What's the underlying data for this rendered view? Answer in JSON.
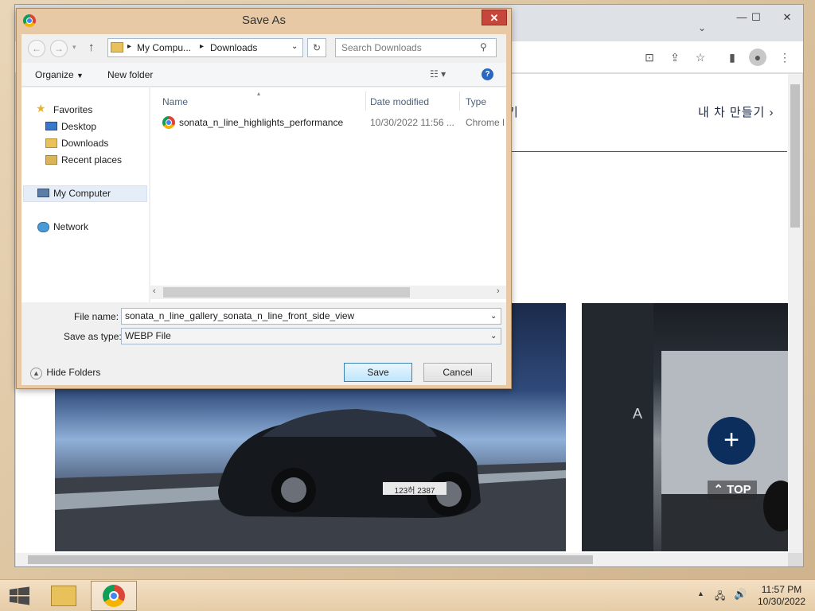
{
  "browser": {
    "korean_link": "내 차 만들기",
    "partial_korean": "기",
    "top_button": "TOP",
    "plate_text": "123허 2387"
  },
  "dialog": {
    "title": "Save As",
    "breadcrumb": [
      "My Compu...",
      "Downloads"
    ],
    "search_placeholder": "Search Downloads",
    "organize_label": "Organize",
    "new_folder_label": "New folder",
    "nav": {
      "favorites": "Favorites",
      "items": [
        "Desktop",
        "Downloads",
        "Recent places"
      ],
      "my_computer": "My Computer",
      "network": "Network"
    },
    "columns": {
      "name": "Name",
      "date": "Date modified",
      "type": "Type"
    },
    "files": [
      {
        "name": "sonata_n_line_highlights_performance",
        "date": "10/30/2022 11:56 ...",
        "type": "Chrome H"
      }
    ],
    "file_name_label": "File name:",
    "file_name_value": "sonata_n_line_gallery_sonata_n_line_front_side_view",
    "save_type_label": "Save as type:",
    "save_type_value": "WEBP File",
    "hide_folders": "Hide Folders",
    "save_button": "Save",
    "cancel_button": "Cancel"
  },
  "taskbar": {
    "time": "11:57 PM",
    "date": "10/30/2022"
  }
}
